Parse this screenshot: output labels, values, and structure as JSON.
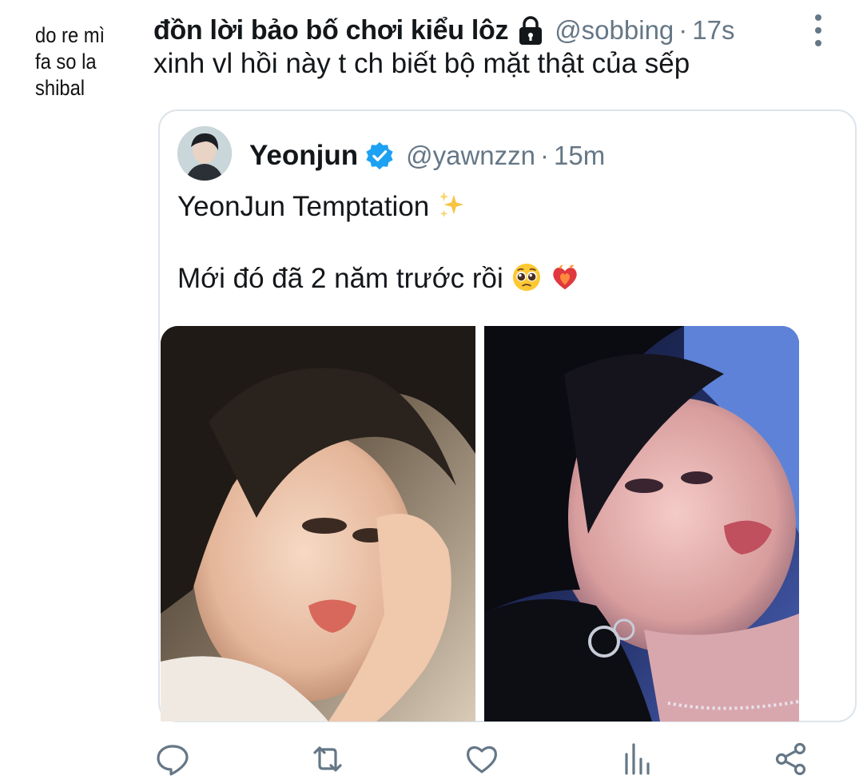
{
  "profile": {
    "avatar_lines": [
      "do re mì",
      "fa  so  la",
      "shibal"
    ]
  },
  "tweet": {
    "display_name": "đồn lời bảo bố chơi kiểu lôz",
    "handle": "@sobbing",
    "separator": "·",
    "time": "17s",
    "text": "xinh vl hồi này t ch biết bộ mặt thật của sếp",
    "locked": true
  },
  "quote": {
    "display_name": "Yeonjun",
    "verified": true,
    "handle": "@yawnzzn",
    "separator": "·",
    "time": "15m",
    "line1": "YeonJun Temptation",
    "line1_emoji": "sparkles",
    "line2": "Mới đó đã 2 năm trước rồi",
    "line2_emojis": [
      "pleading-face",
      "heart-on-fire"
    ],
    "photos": [
      "photo-1",
      "photo-2"
    ]
  },
  "actions": [
    {
      "name": "reply",
      "icon": "reply-icon"
    },
    {
      "name": "retweet",
      "icon": "retweet-icon"
    },
    {
      "name": "like",
      "icon": "heart-icon"
    },
    {
      "name": "analytics",
      "icon": "analytics-icon"
    },
    {
      "name": "share",
      "icon": "share-icon"
    }
  ],
  "colors": {
    "text": "#14171a",
    "muted": "#657786",
    "verified": "#1da1f2",
    "border": "#dde4ea"
  }
}
